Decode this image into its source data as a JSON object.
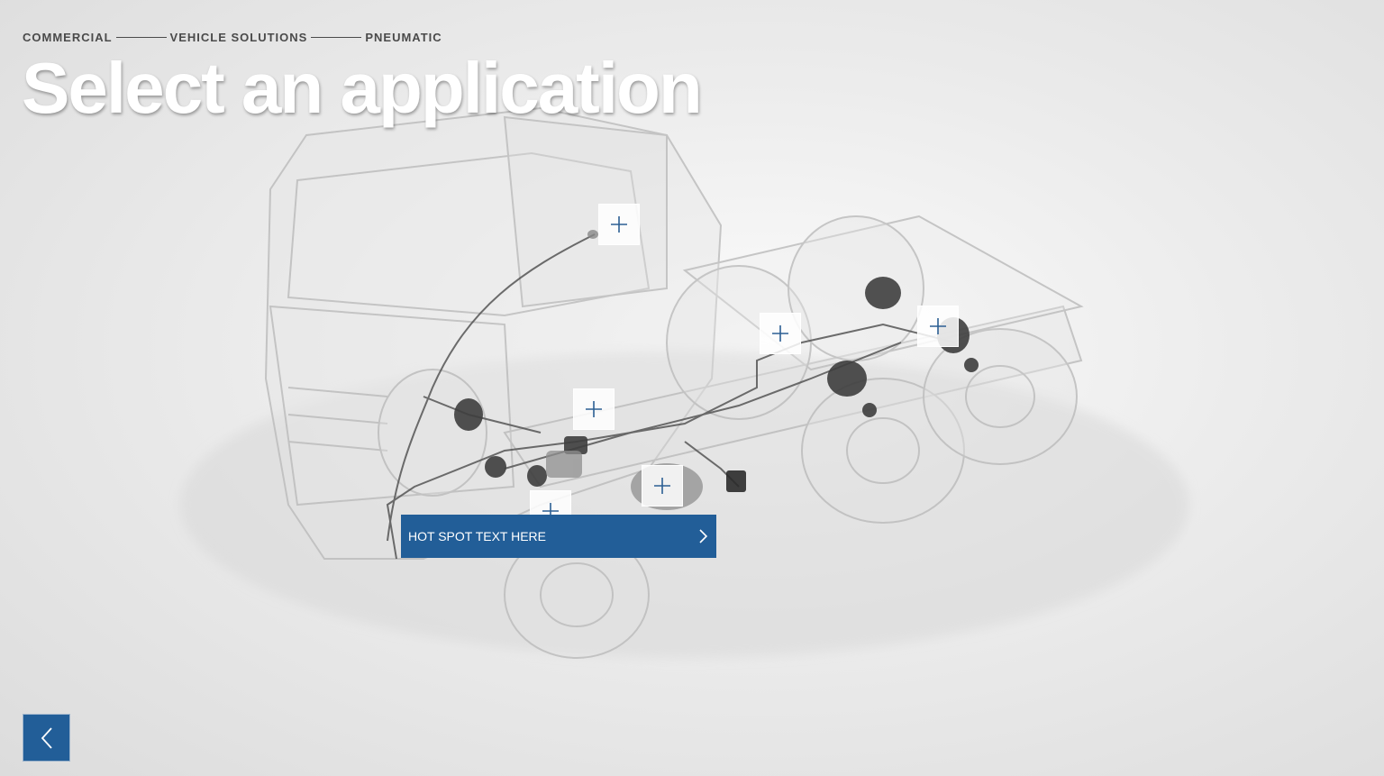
{
  "breadcrumb": {
    "items": [
      "COMMERCIAL",
      "VEHICLE SOLUTIONS",
      "PNEUMATIC"
    ]
  },
  "page_title": "Select an application",
  "hotspots": [
    {
      "name": "hotspot-cab",
      "icon": "plus-icon"
    },
    {
      "name": "hotspot-rear-axle-1",
      "icon": "plus-icon"
    },
    {
      "name": "hotspot-rear-axle-2",
      "icon": "plus-icon"
    },
    {
      "name": "hotspot-front-axle",
      "icon": "plus-icon"
    },
    {
      "name": "hotspot-tank",
      "icon": "plus-icon"
    },
    {
      "name": "hotspot-compressor",
      "icon": "plus-icon"
    }
  ],
  "popup": {
    "label": "HOT SPOT TEXT HERE",
    "icon": "chevron-right-icon"
  },
  "back_button": {
    "icon": "chevron-left-icon"
  },
  "colors": {
    "accent": "#225e98",
    "hotspot_plus": "#2c5f93",
    "title": "#ffffff",
    "breadcrumb": "#4a4a4a"
  }
}
